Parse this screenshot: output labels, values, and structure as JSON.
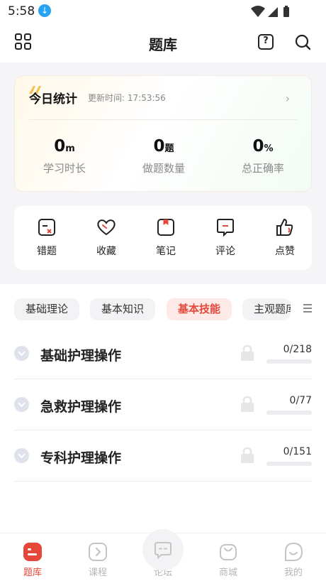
{
  "status": {
    "time": "5:58",
    "download_badge": "↓"
  },
  "header": {
    "title": "题库",
    "help_glyph": "?"
  },
  "today": {
    "title": "今日统计",
    "update_label": "更新时间:",
    "update_time": "17:53:56",
    "stats": [
      {
        "value": "0",
        "unit": "m",
        "label": "学习时长"
      },
      {
        "value": "0",
        "unit": "题",
        "label": "做题数量"
      },
      {
        "value": "0",
        "unit": "%",
        "label": "总正确率"
      }
    ]
  },
  "quick_actions": [
    {
      "label": "错题",
      "icon": "wrong-note-icon"
    },
    {
      "label": "收藏",
      "icon": "heart-icon"
    },
    {
      "label": "笔记",
      "icon": "bookmark-note-icon"
    },
    {
      "label": "评论",
      "icon": "comment-icon"
    },
    {
      "label": "点赞",
      "icon": "thumbs-up-icon"
    }
  ],
  "tabs": [
    {
      "label": "基础理论",
      "active": false
    },
    {
      "label": "基本知识",
      "active": false
    },
    {
      "label": "基本技能",
      "active": true
    },
    {
      "label": "主观题库",
      "active": false
    }
  ],
  "subjects": [
    {
      "name": "基础护理操作",
      "done": 0,
      "total": 218,
      "progress_text": "0/218",
      "locked": true
    },
    {
      "name": "急救护理操作",
      "done": 0,
      "total": 77,
      "progress_text": "0/77",
      "locked": true
    },
    {
      "name": "专科护理操作",
      "done": 0,
      "total": 151,
      "progress_text": "0/151",
      "locked": true
    }
  ],
  "nav": [
    {
      "label": "题库",
      "icon": "question-bank-icon",
      "active": true
    },
    {
      "label": "课程",
      "icon": "course-play-icon",
      "active": false
    },
    {
      "label": "论坛",
      "icon": "forum-chat-icon",
      "active": false
    },
    {
      "label": "商城",
      "icon": "shop-bag-icon",
      "active": false
    },
    {
      "label": "我的",
      "icon": "profile-smile-icon",
      "active": false
    }
  ],
  "colors": {
    "accent": "#e5473a",
    "download_badge": "#27a3f3"
  }
}
